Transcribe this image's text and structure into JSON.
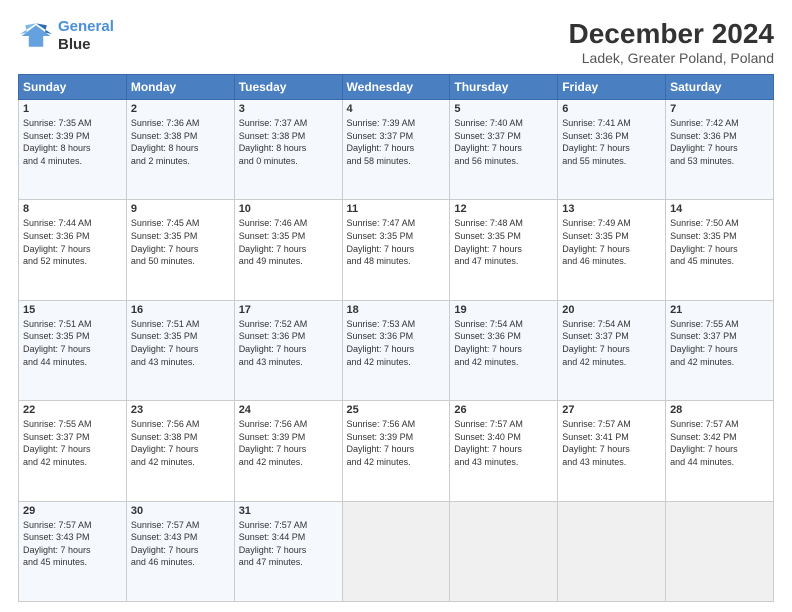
{
  "header": {
    "logo_line1": "General",
    "logo_line2": "Blue",
    "title": "December 2024",
    "subtitle": "Ladek, Greater Poland, Poland"
  },
  "days_of_week": [
    "Sunday",
    "Monday",
    "Tuesday",
    "Wednesday",
    "Thursday",
    "Friday",
    "Saturday"
  ],
  "weeks": [
    [
      {
        "day": "1",
        "info": "Sunrise: 7:35 AM\nSunset: 3:39 PM\nDaylight: 8 hours\nand 4 minutes."
      },
      {
        "day": "2",
        "info": "Sunrise: 7:36 AM\nSunset: 3:38 PM\nDaylight: 8 hours\nand 2 minutes."
      },
      {
        "day": "3",
        "info": "Sunrise: 7:37 AM\nSunset: 3:38 PM\nDaylight: 8 hours\nand 0 minutes."
      },
      {
        "day": "4",
        "info": "Sunrise: 7:39 AM\nSunset: 3:37 PM\nDaylight: 7 hours\nand 58 minutes."
      },
      {
        "day": "5",
        "info": "Sunrise: 7:40 AM\nSunset: 3:37 PM\nDaylight: 7 hours\nand 56 minutes."
      },
      {
        "day": "6",
        "info": "Sunrise: 7:41 AM\nSunset: 3:36 PM\nDaylight: 7 hours\nand 55 minutes."
      },
      {
        "day": "7",
        "info": "Sunrise: 7:42 AM\nSunset: 3:36 PM\nDaylight: 7 hours\nand 53 minutes."
      }
    ],
    [
      {
        "day": "8",
        "info": "Sunrise: 7:44 AM\nSunset: 3:36 PM\nDaylight: 7 hours\nand 52 minutes."
      },
      {
        "day": "9",
        "info": "Sunrise: 7:45 AM\nSunset: 3:35 PM\nDaylight: 7 hours\nand 50 minutes."
      },
      {
        "day": "10",
        "info": "Sunrise: 7:46 AM\nSunset: 3:35 PM\nDaylight: 7 hours\nand 49 minutes."
      },
      {
        "day": "11",
        "info": "Sunrise: 7:47 AM\nSunset: 3:35 PM\nDaylight: 7 hours\nand 48 minutes."
      },
      {
        "day": "12",
        "info": "Sunrise: 7:48 AM\nSunset: 3:35 PM\nDaylight: 7 hours\nand 47 minutes."
      },
      {
        "day": "13",
        "info": "Sunrise: 7:49 AM\nSunset: 3:35 PM\nDaylight: 7 hours\nand 46 minutes."
      },
      {
        "day": "14",
        "info": "Sunrise: 7:50 AM\nSunset: 3:35 PM\nDaylight: 7 hours\nand 45 minutes."
      }
    ],
    [
      {
        "day": "15",
        "info": "Sunrise: 7:51 AM\nSunset: 3:35 PM\nDaylight: 7 hours\nand 44 minutes."
      },
      {
        "day": "16",
        "info": "Sunrise: 7:51 AM\nSunset: 3:35 PM\nDaylight: 7 hours\nand 43 minutes."
      },
      {
        "day": "17",
        "info": "Sunrise: 7:52 AM\nSunset: 3:36 PM\nDaylight: 7 hours\nand 43 minutes."
      },
      {
        "day": "18",
        "info": "Sunrise: 7:53 AM\nSunset: 3:36 PM\nDaylight: 7 hours\nand 42 minutes."
      },
      {
        "day": "19",
        "info": "Sunrise: 7:54 AM\nSunset: 3:36 PM\nDaylight: 7 hours\nand 42 minutes."
      },
      {
        "day": "20",
        "info": "Sunrise: 7:54 AM\nSunset: 3:37 PM\nDaylight: 7 hours\nand 42 minutes."
      },
      {
        "day": "21",
        "info": "Sunrise: 7:55 AM\nSunset: 3:37 PM\nDaylight: 7 hours\nand 42 minutes."
      }
    ],
    [
      {
        "day": "22",
        "info": "Sunrise: 7:55 AM\nSunset: 3:37 PM\nDaylight: 7 hours\nand 42 minutes."
      },
      {
        "day": "23",
        "info": "Sunrise: 7:56 AM\nSunset: 3:38 PM\nDaylight: 7 hours\nand 42 minutes."
      },
      {
        "day": "24",
        "info": "Sunrise: 7:56 AM\nSunset: 3:39 PM\nDaylight: 7 hours\nand 42 minutes."
      },
      {
        "day": "25",
        "info": "Sunrise: 7:56 AM\nSunset: 3:39 PM\nDaylight: 7 hours\nand 42 minutes."
      },
      {
        "day": "26",
        "info": "Sunrise: 7:57 AM\nSunset: 3:40 PM\nDaylight: 7 hours\nand 43 minutes."
      },
      {
        "day": "27",
        "info": "Sunrise: 7:57 AM\nSunset: 3:41 PM\nDaylight: 7 hours\nand 43 minutes."
      },
      {
        "day": "28",
        "info": "Sunrise: 7:57 AM\nSunset: 3:42 PM\nDaylight: 7 hours\nand 44 minutes."
      }
    ],
    [
      {
        "day": "29",
        "info": "Sunrise: 7:57 AM\nSunset: 3:43 PM\nDaylight: 7 hours\nand 45 minutes."
      },
      {
        "day": "30",
        "info": "Sunrise: 7:57 AM\nSunset: 3:43 PM\nDaylight: 7 hours\nand 46 minutes."
      },
      {
        "day": "31",
        "info": "Sunrise: 7:57 AM\nSunset: 3:44 PM\nDaylight: 7 hours\nand 47 minutes."
      },
      {
        "day": "",
        "info": ""
      },
      {
        "day": "",
        "info": ""
      },
      {
        "day": "",
        "info": ""
      },
      {
        "day": "",
        "info": ""
      }
    ]
  ]
}
